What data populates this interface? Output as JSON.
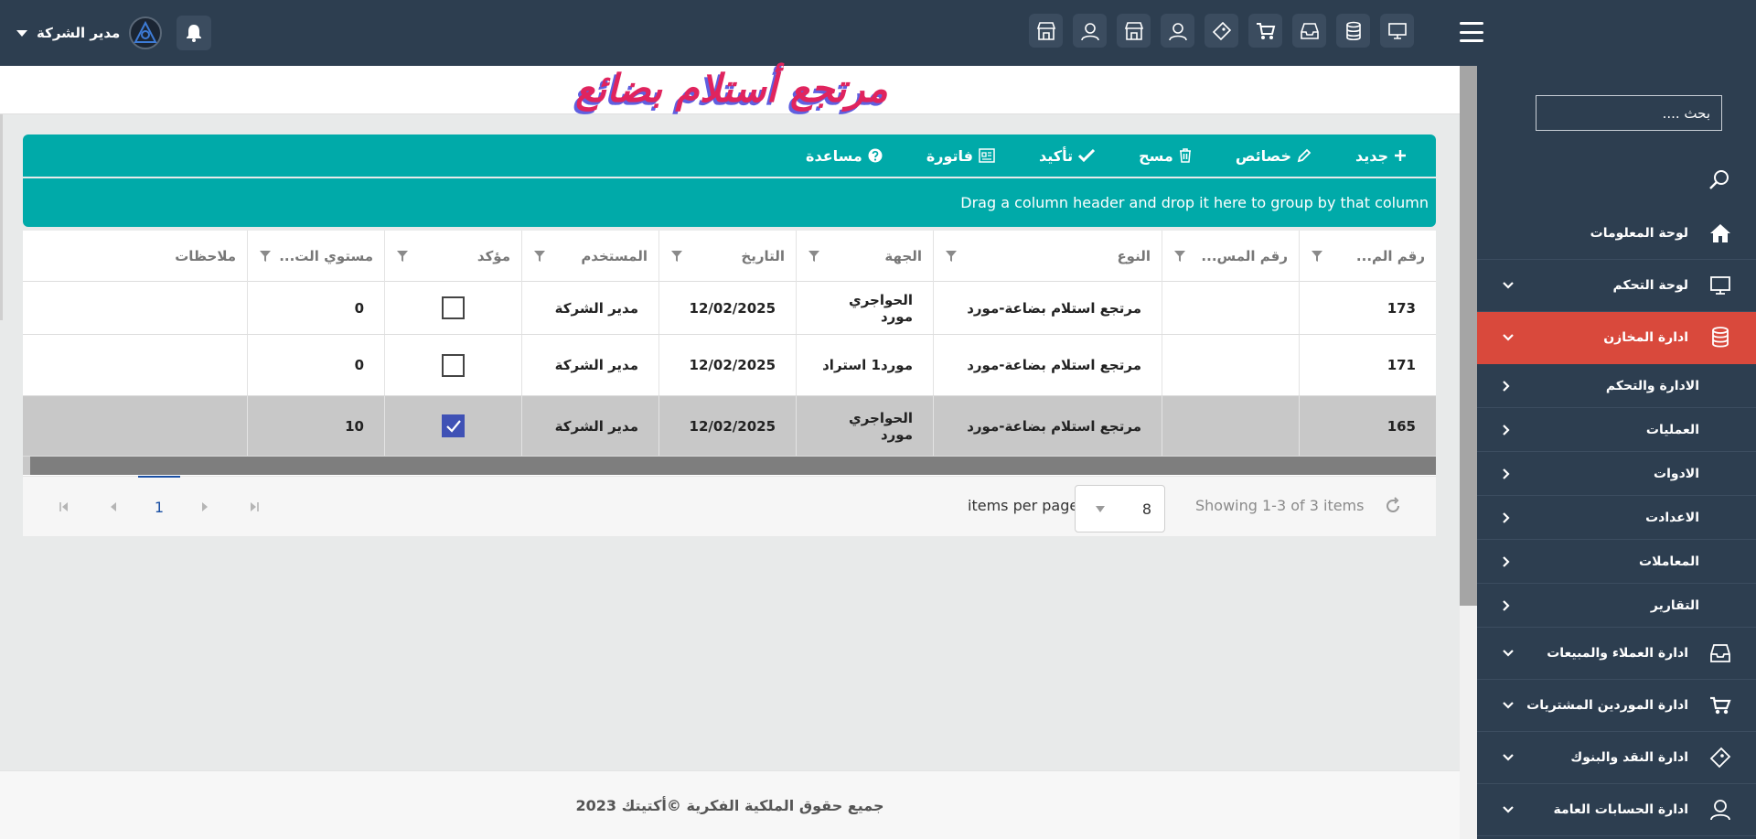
{
  "header": {
    "user_name": "مدير الشركة",
    "top_icons": [
      "monitor-icon",
      "database-icon",
      "inbox-icon",
      "cart-icon",
      "ticket-icon",
      "user-icon",
      "store-icon",
      "user-icon",
      "store-icon"
    ]
  },
  "sidebar": {
    "search_placeholder": "بحث ....",
    "items": [
      {
        "label": "لوحة المعلومات",
        "icon": "home-icon",
        "has_caret": false
      },
      {
        "label": "لوحة التحكم",
        "icon": "monitor-icon",
        "has_caret": true
      },
      {
        "label": "ادارة المخازن",
        "icon": "database-icon",
        "has_caret": true,
        "active": true
      }
    ],
    "subitems": [
      {
        "label": "الادارة والتحكم"
      },
      {
        "label": "العمليات"
      },
      {
        "label": "الادوات"
      },
      {
        "label": "الاعدادت"
      },
      {
        "label": "المعاملات"
      },
      {
        "label": "التقارير"
      }
    ],
    "items_after": [
      {
        "label": "ادارة العملاء والمبيعات",
        "icon": "inbox-icon"
      },
      {
        "label": "ادارة الموردين المشتريات",
        "icon": "cart-icon"
      },
      {
        "label": "ادارة النقد والبنوك",
        "icon": "ticket-icon"
      },
      {
        "label": "ادارة الحسابات العامة",
        "icon": "user-icon"
      }
    ]
  },
  "page": {
    "title": "مرتجع أستلام بضائع"
  },
  "toolbar": {
    "new": "جديد",
    "properties": "خصائص",
    "delete": "مسح",
    "confirm": "تأكيد",
    "invoice": "فاتورة",
    "help": "مساعدة"
  },
  "grid": {
    "group_hint": "Drag a column header and drop it here to group by that column",
    "columns": [
      "رقم الم...",
      "رقم المس...",
      "النوع",
      "الجهة",
      "التاريخ",
      "المستخدم",
      "مؤكد",
      "مستوي الت...",
      "ملاحظات"
    ],
    "rows": [
      {
        "id": "173",
        "ref": "",
        "type": "مرتجع استلام بضاعة-مورد",
        "party": "الحواجري مورد",
        "date": "12/02/2025",
        "user": "مدير الشركة",
        "confirmed": false,
        "level": "0",
        "notes": ""
      },
      {
        "id": "171",
        "ref": "",
        "type": "مرتجع استلام بضاعة-مورد",
        "party": "مورد1 استراد",
        "date": "12/02/2025",
        "user": "مدير الشركة",
        "confirmed": false,
        "level": "0",
        "notes": ""
      },
      {
        "id": "165",
        "ref": "",
        "type": "مرتجع استلام بضاعة-مورد",
        "party": "الحواجري مورد",
        "date": "12/02/2025",
        "user": "مدير الشركة",
        "confirmed": true,
        "level": "10",
        "notes": ""
      }
    ]
  },
  "pager": {
    "current_page": "1",
    "per_page_value": "8",
    "per_page_label": "items per page",
    "showing": "Showing 1-3 of 3 items"
  },
  "footer": {
    "text": "جميع حقوق الملكية الفكرية ©أكتيتك 2023"
  }
}
